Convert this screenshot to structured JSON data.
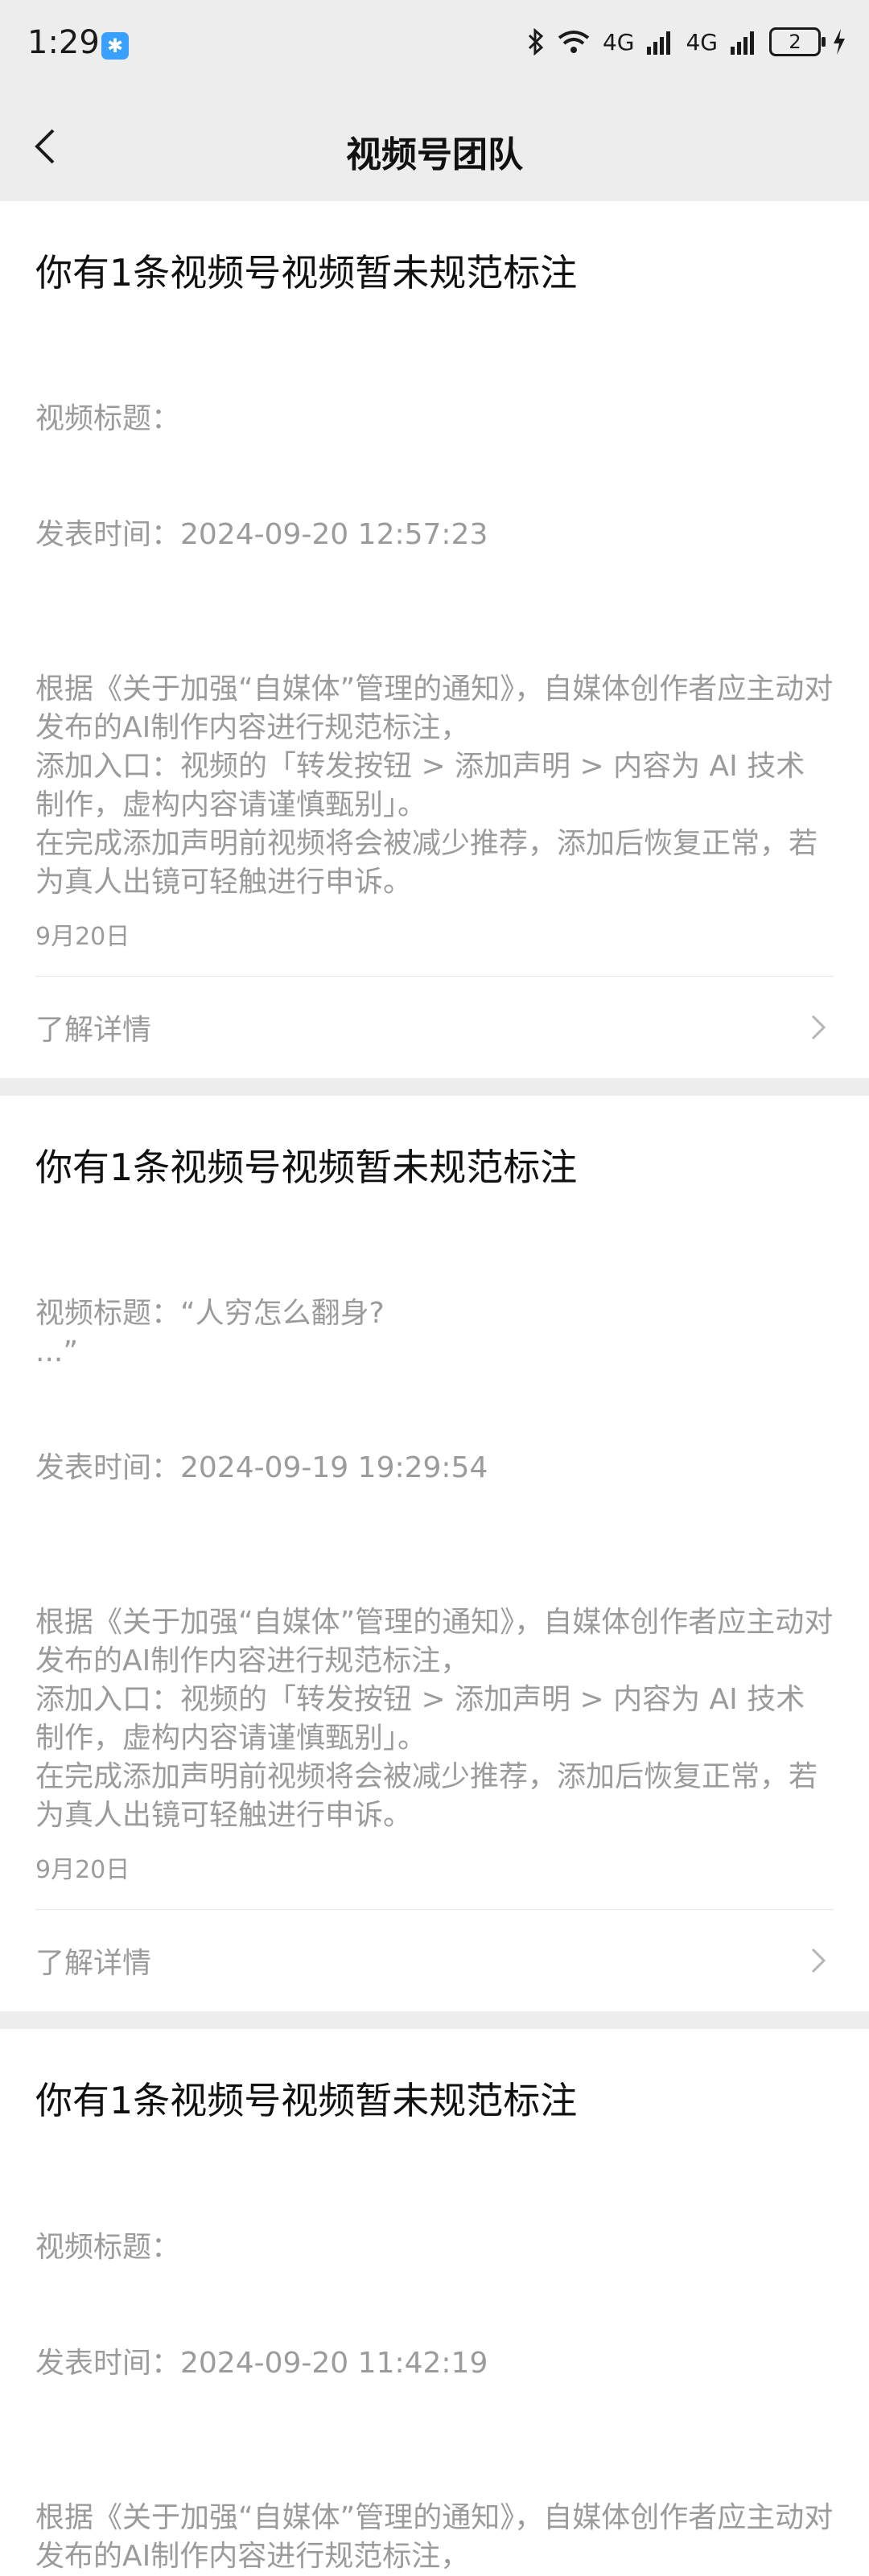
{
  "status": {
    "time": "1:29",
    "bluetooth_badge": "✱",
    "net_1": "4G",
    "net_2": "4G",
    "battery": "2"
  },
  "header": {
    "title": "视频号团队"
  },
  "messages": [
    {
      "title": "你有1条视频号视频暂未规范标注",
      "video_title_line": "视频标题：",
      "publish_line": "发表时间：2024-09-20 12:57:23",
      "body": [
        "根据《关于加强“自媒体”管理的通知》，自媒体创作者应主动对发布的AI制作内容进行规范标注，",
        "添加入口：视频的「转发按钮 > 添加声明 > 内容为 AI 技术制作，虚构内容请谨慎甄别」。",
        "在完成添加声明前视频将会被减少推荐，添加后恢复正常，若为真人出镜可轻触进行申诉。"
      ],
      "date": "9月20日",
      "detail_label": "了解详情"
    },
    {
      "title": "你有1条视频号视频暂未规范标注",
      "video_title_line": "视频标题：“人穷怎么翻身?\n...”",
      "publish_line": "发表时间：2024-09-19 19:29:54",
      "body": [
        "根据《关于加强“自媒体”管理的通知》，自媒体创作者应主动对发布的AI制作内容进行规范标注，",
        "添加入口：视频的「转发按钮 > 添加声明 > 内容为 AI 技术制作，虚构内容请谨慎甄别」。",
        "在完成添加声明前视频将会被减少推荐，添加后恢复正常，若为真人出镜可轻触进行申诉。"
      ],
      "date": "9月20日",
      "detail_label": "了解详情"
    },
    {
      "title": "你有1条视频号视频暂未规范标注",
      "video_title_line": "视频标题：",
      "publish_line": "发表时间：2024-09-20 11:42:19",
      "body": [
        "根据《关于加强“自媒体”管理的通知》，自媒体创作者应主动对发布的AI制作内容进行规范标注，"
      ]
    }
  ]
}
